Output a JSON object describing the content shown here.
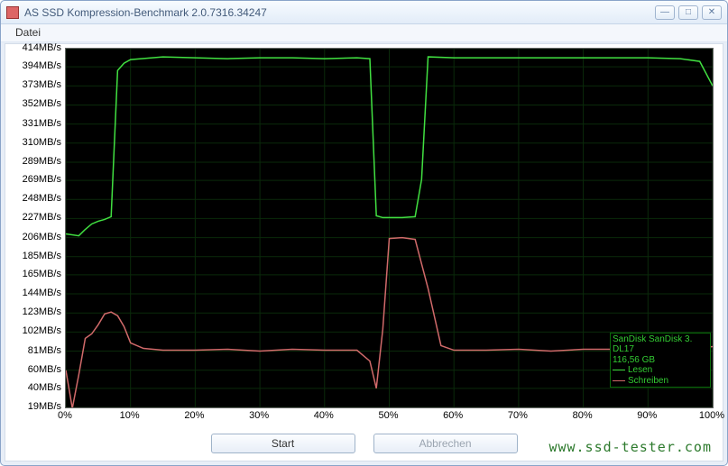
{
  "window": {
    "title": "AS SSD Kompression-Benchmark 2.0.7316.34247",
    "btn_min": "—",
    "btn_max": "□",
    "btn_close": "✕"
  },
  "menu": {
    "file": "Datei"
  },
  "buttons": {
    "start": "Start",
    "abort": "Abbrechen"
  },
  "watermark": "www.ssd-tester.com",
  "legend": {
    "device_line1": "SanDisk SanDisk 3.",
    "device_line2": "DL17",
    "capacity": "116,56 GB",
    "read": "Lesen",
    "write": "Schreiben"
  },
  "chart_data": {
    "type": "line",
    "xlabel": "",
    "ylabel": "",
    "xlim": [
      0,
      100
    ],
    "ylim": [
      19,
      414
    ],
    "x_ticks": [
      0,
      10,
      20,
      30,
      40,
      50,
      60,
      70,
      80,
      90,
      100
    ],
    "y_ticks": [
      19,
      40,
      60,
      81,
      102,
      123,
      144,
      165,
      185,
      206,
      227,
      248,
      269,
      289,
      310,
      331,
      352,
      373,
      394,
      414
    ],
    "x_tick_suffix": "%",
    "y_tick_suffix": "MB/s",
    "series": [
      {
        "name": "Lesen",
        "color": "#41e041",
        "x": [
          0,
          2,
          3,
          4,
          5,
          6,
          7,
          8,
          9,
          10,
          15,
          20,
          25,
          30,
          35,
          40,
          45,
          47,
          48,
          49,
          50,
          52,
          54,
          55,
          56,
          60,
          70,
          80,
          90,
          95,
          98,
          100
        ],
        "values": [
          210,
          208,
          215,
          221,
          224,
          226,
          229,
          390,
          398,
          402,
          405,
          404,
          403,
          404,
          404,
          403,
          404,
          403,
          230,
          228,
          228,
          228,
          229,
          270,
          405,
          404,
          404,
          404,
          404,
          403,
          400,
          373
        ]
      },
      {
        "name": "Schreiben",
        "color": "#d16a6a",
        "x": [
          0,
          1,
          2,
          3,
          4,
          5,
          6,
          7,
          8,
          9,
          10,
          12,
          15,
          20,
          25,
          30,
          35,
          40,
          45,
          47,
          48,
          49,
          50,
          52,
          54,
          56,
          58,
          60,
          65,
          70,
          75,
          80,
          85,
          90,
          95,
          100
        ],
        "values": [
          60,
          18,
          55,
          95,
          100,
          110,
          122,
          124,
          120,
          108,
          90,
          84,
          82,
          82,
          83,
          81,
          83,
          82,
          82,
          70,
          40,
          105,
          205,
          206,
          204,
          150,
          87,
          82,
          82,
          83,
          81,
          83,
          83,
          81,
          82,
          86
        ]
      }
    ]
  }
}
